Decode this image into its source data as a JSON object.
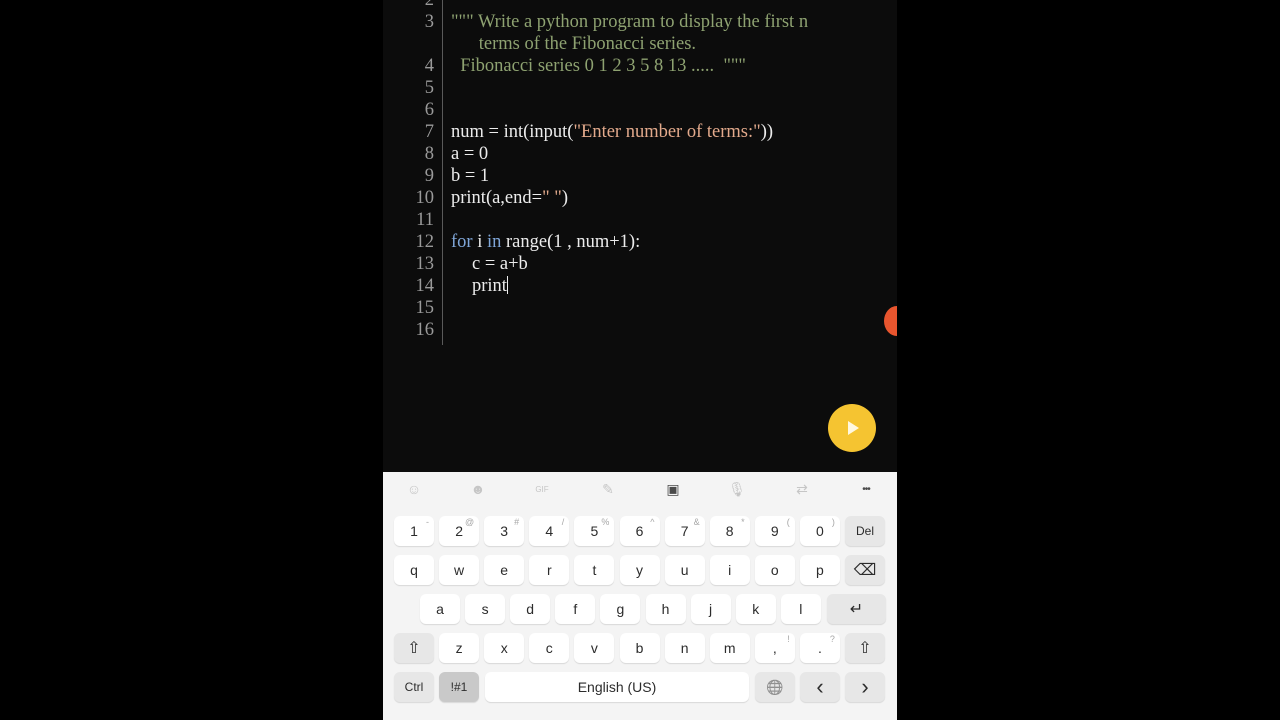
{
  "editor": {
    "lines": [
      {
        "n": "2",
        "indent": 0,
        "parts": []
      },
      {
        "n": "3",
        "indent": 0,
        "parts": [
          {
            "t": "\"\"\" Write a python program to display the first n",
            "c": "doc"
          }
        ]
      },
      {
        "n": "",
        "indent": 0,
        "parts": [
          {
            "t": "      terms of the Fibonacci series.",
            "c": "doc"
          }
        ]
      },
      {
        "n": "4",
        "indent": 0,
        "parts": [
          {
            "t": "  Fibonacci series 0 1 2 3 5 8 13 .....  \"\"\"",
            "c": "doc"
          }
        ]
      },
      {
        "n": "5",
        "indent": 0,
        "parts": []
      },
      {
        "n": "6",
        "indent": 0,
        "parts": []
      },
      {
        "n": "7",
        "indent": 0,
        "parts": [
          {
            "t": "num = int(input(",
            "c": ""
          },
          {
            "t": "\"Enter number of terms:\"",
            "c": "str"
          },
          {
            "t": "))",
            "c": ""
          }
        ]
      },
      {
        "n": "8",
        "indent": 0,
        "parts": [
          {
            "t": "a = 0",
            "c": ""
          }
        ]
      },
      {
        "n": "9",
        "indent": 0,
        "parts": [
          {
            "t": "b = 1",
            "c": ""
          }
        ]
      },
      {
        "n": "10",
        "indent": 0,
        "parts": [
          {
            "t": "print(a,end=",
            "c": ""
          },
          {
            "t": "\" \"",
            "c": "str"
          },
          {
            "t": ")",
            "c": ""
          }
        ]
      },
      {
        "n": "11",
        "indent": 0,
        "parts": []
      },
      {
        "n": "12",
        "indent": 0,
        "parts": [
          {
            "t": "for",
            "c": "kw"
          },
          {
            "t": " i ",
            "c": ""
          },
          {
            "t": "in",
            "c": "kw"
          },
          {
            "t": " range(1 , num+1):",
            "c": ""
          }
        ]
      },
      {
        "n": "13",
        "indent": 2,
        "parts": [
          {
            "t": "c = a+b",
            "c": ""
          }
        ]
      },
      {
        "n": "14",
        "indent": 2,
        "parts": [
          {
            "t": "print",
            "c": ""
          }
        ],
        "caret": true
      },
      {
        "n": "15",
        "indent": 0,
        "parts": []
      },
      {
        "n": "16",
        "indent": 0,
        "parts": []
      }
    ]
  },
  "run_button": {
    "icon": "play-icon"
  },
  "keyboard": {
    "toolbar": [
      {
        "name": "emoji-icon",
        "glyph": "☺"
      },
      {
        "name": "sticker-icon",
        "glyph": "☻"
      },
      {
        "name": "gif-icon",
        "glyph": "GIF"
      },
      {
        "name": "handwriting-icon",
        "glyph": "✎"
      },
      {
        "name": "clipboard-icon",
        "glyph": "▣",
        "active": true
      },
      {
        "name": "microphone-icon",
        "glyph": "🎙"
      },
      {
        "name": "translate-icon",
        "glyph": "⇄"
      },
      {
        "name": "more-options-icon",
        "glyph": "•••",
        "active": true
      }
    ],
    "row1": [
      {
        "k": "1",
        "s": "-"
      },
      {
        "k": "2",
        "s": "@"
      },
      {
        "k": "3",
        "s": "#"
      },
      {
        "k": "4",
        "s": "/"
      },
      {
        "k": "5",
        "s": "%"
      },
      {
        "k": "6",
        "s": "^"
      },
      {
        "k": "7",
        "s": "&"
      },
      {
        "k": "8",
        "s": "*"
      },
      {
        "k": "9",
        "s": "("
      },
      {
        "k": "0",
        "s": ")"
      },
      {
        "k": "Del",
        "s": "",
        "dark": true
      }
    ],
    "row2": [
      {
        "k": "q"
      },
      {
        "k": "w"
      },
      {
        "k": "e"
      },
      {
        "k": "r"
      },
      {
        "k": "t"
      },
      {
        "k": "y"
      },
      {
        "k": "u"
      },
      {
        "k": "i"
      },
      {
        "k": "o"
      },
      {
        "k": "p"
      },
      {
        "k": "⌫",
        "dark": true,
        "name": "backspace-key"
      }
    ],
    "row3": [
      {
        "k": "a"
      },
      {
        "k": "s"
      },
      {
        "k": "d"
      },
      {
        "k": "f"
      },
      {
        "k": "g"
      },
      {
        "k": "h"
      },
      {
        "k": "j"
      },
      {
        "k": "k"
      },
      {
        "k": "l"
      },
      {
        "k": "↵",
        "dark": true,
        "name": "enter-key"
      }
    ],
    "row4": [
      {
        "k": "⇧",
        "dark": true,
        "name": "shift-left-key"
      },
      {
        "k": "z"
      },
      {
        "k": "x"
      },
      {
        "k": "c"
      },
      {
        "k": "v"
      },
      {
        "k": "b"
      },
      {
        "k": "n"
      },
      {
        "k": "m"
      },
      {
        "k": ",",
        "s": "!"
      },
      {
        "k": ".",
        "s": "?"
      },
      {
        "k": "⇧",
        "dark": true,
        "name": "shift-right-key"
      }
    ],
    "row5": {
      "ctrl": "Ctrl",
      "sym": "!#1",
      "space": "English (US)",
      "globe": "🌐",
      "left": "‹",
      "right": "›"
    }
  }
}
